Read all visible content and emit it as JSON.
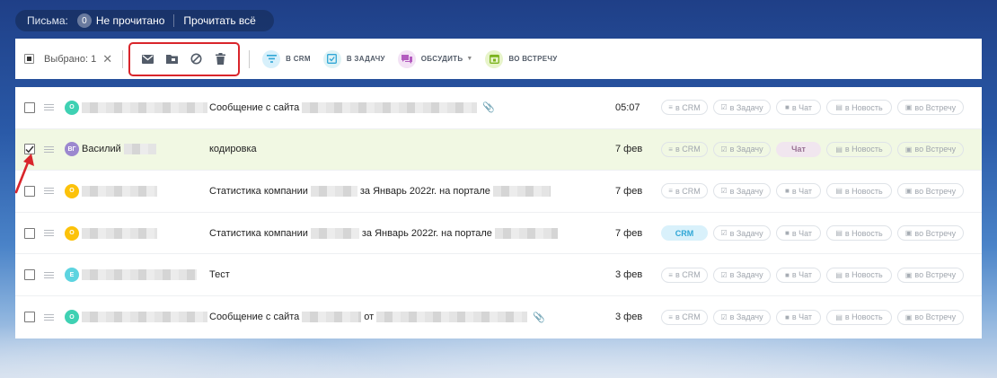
{
  "topbar": {
    "label": "Письма:",
    "count": "0",
    "unread": "Не прочитано",
    "read_all": "Прочитать всё"
  },
  "actionbar": {
    "selected": "Выбрано: 1",
    "actions": {
      "crm": "в CRM",
      "task": "в задачу",
      "discuss": "обсудить",
      "meet": "во встречу"
    }
  },
  "buttons": {
    "crm": "в CRM",
    "task": "в Задачу",
    "chat": "в Чат",
    "news": "в Новость",
    "meet": "во Встречу"
  },
  "rows": [
    {
      "avatar": "О",
      "avatar_color": "#3fd1b3",
      "from": "",
      "subject_pre": "Сообщение с сайта",
      "subject_mid": "",
      "subject_post": "",
      "date": "05:07",
      "attach": true,
      "checked": false
    },
    {
      "avatar": "ВГ",
      "avatar_color": "#9c88cf",
      "from": "Василий",
      "subject_pre": "кодировка",
      "subject_mid": "",
      "subject_post": "",
      "date": "7 фев",
      "attach": false,
      "checked": true,
      "chat_state": "Чат"
    },
    {
      "avatar": "О",
      "avatar_color": "#fcc20a",
      "from": "",
      "subject_pre": "Статистика компании",
      "subject_mid": "за Январь 2022г. на портале",
      "subject_post": "",
      "date": "7 фев",
      "attach": false,
      "checked": false
    },
    {
      "avatar": "О",
      "avatar_color": "#fcc20a",
      "from": "",
      "subject_pre": "Статистика компании",
      "subject_mid": "за Январь 2022г. на портале",
      "subject_post": "",
      "date": "7 фев",
      "attach": false,
      "checked": false,
      "crm_state": "CRM"
    },
    {
      "avatar": "Е",
      "avatar_color": "#5dd4e0",
      "from": "",
      "subject_pre": "Тест",
      "subject_mid": "",
      "subject_post": "",
      "date": "3 фев",
      "attach": false,
      "checked": false
    },
    {
      "avatar": "О",
      "avatar_color": "#3fd1b3",
      "from": "",
      "subject_pre": "Сообщение с сайта",
      "subject_mid": "от",
      "subject_post": "",
      "date": "3 фев",
      "attach": true,
      "checked": false
    }
  ],
  "colors": {
    "highlight": "#d9252b",
    "row_selected": "#f1f8e3",
    "crm_active": "#2fa6d6"
  }
}
